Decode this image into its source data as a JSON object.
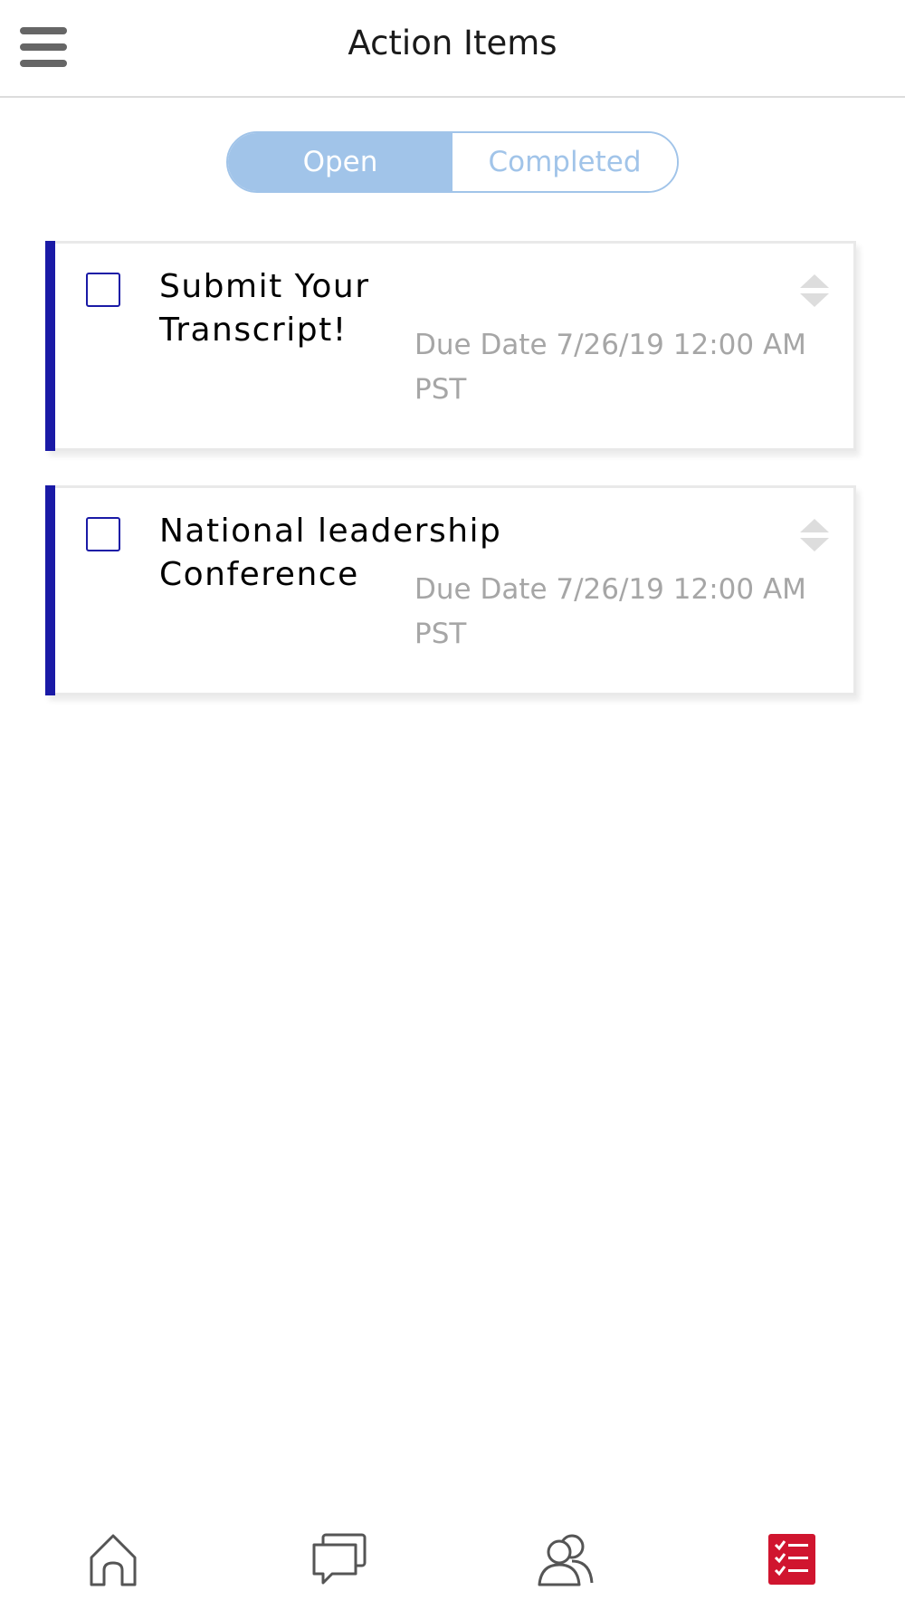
{
  "header": {
    "title": "Action Items",
    "menu_icon": "hamburger-menu-icon"
  },
  "tabs": [
    {
      "label": "Open",
      "active": true
    },
    {
      "label": "Completed",
      "active": false
    }
  ],
  "colors": {
    "accent_blue": "#1a1aa6",
    "segment_blue": "#a1c4e9",
    "active_nav_red": "#d0152f",
    "muted_text": "#a6a6a6"
  },
  "action_items": [
    {
      "title": "Submit Your Transcript!",
      "due_line1": "Due Date 7/26/19 12:00 AM",
      "due_line2": "PST",
      "checked": false
    },
    {
      "title_line1": "National leadership",
      "title_line2": "Conference",
      "due_line1": "Due Date 7/26/19 12:00 AM",
      "due_line2": "PST",
      "checked": false
    }
  ],
  "bottom_nav": [
    {
      "icon": "home-icon",
      "active": false
    },
    {
      "icon": "chat-icon",
      "active": false
    },
    {
      "icon": "people-icon",
      "active": false
    },
    {
      "icon": "checklist-icon",
      "active": true
    }
  ]
}
